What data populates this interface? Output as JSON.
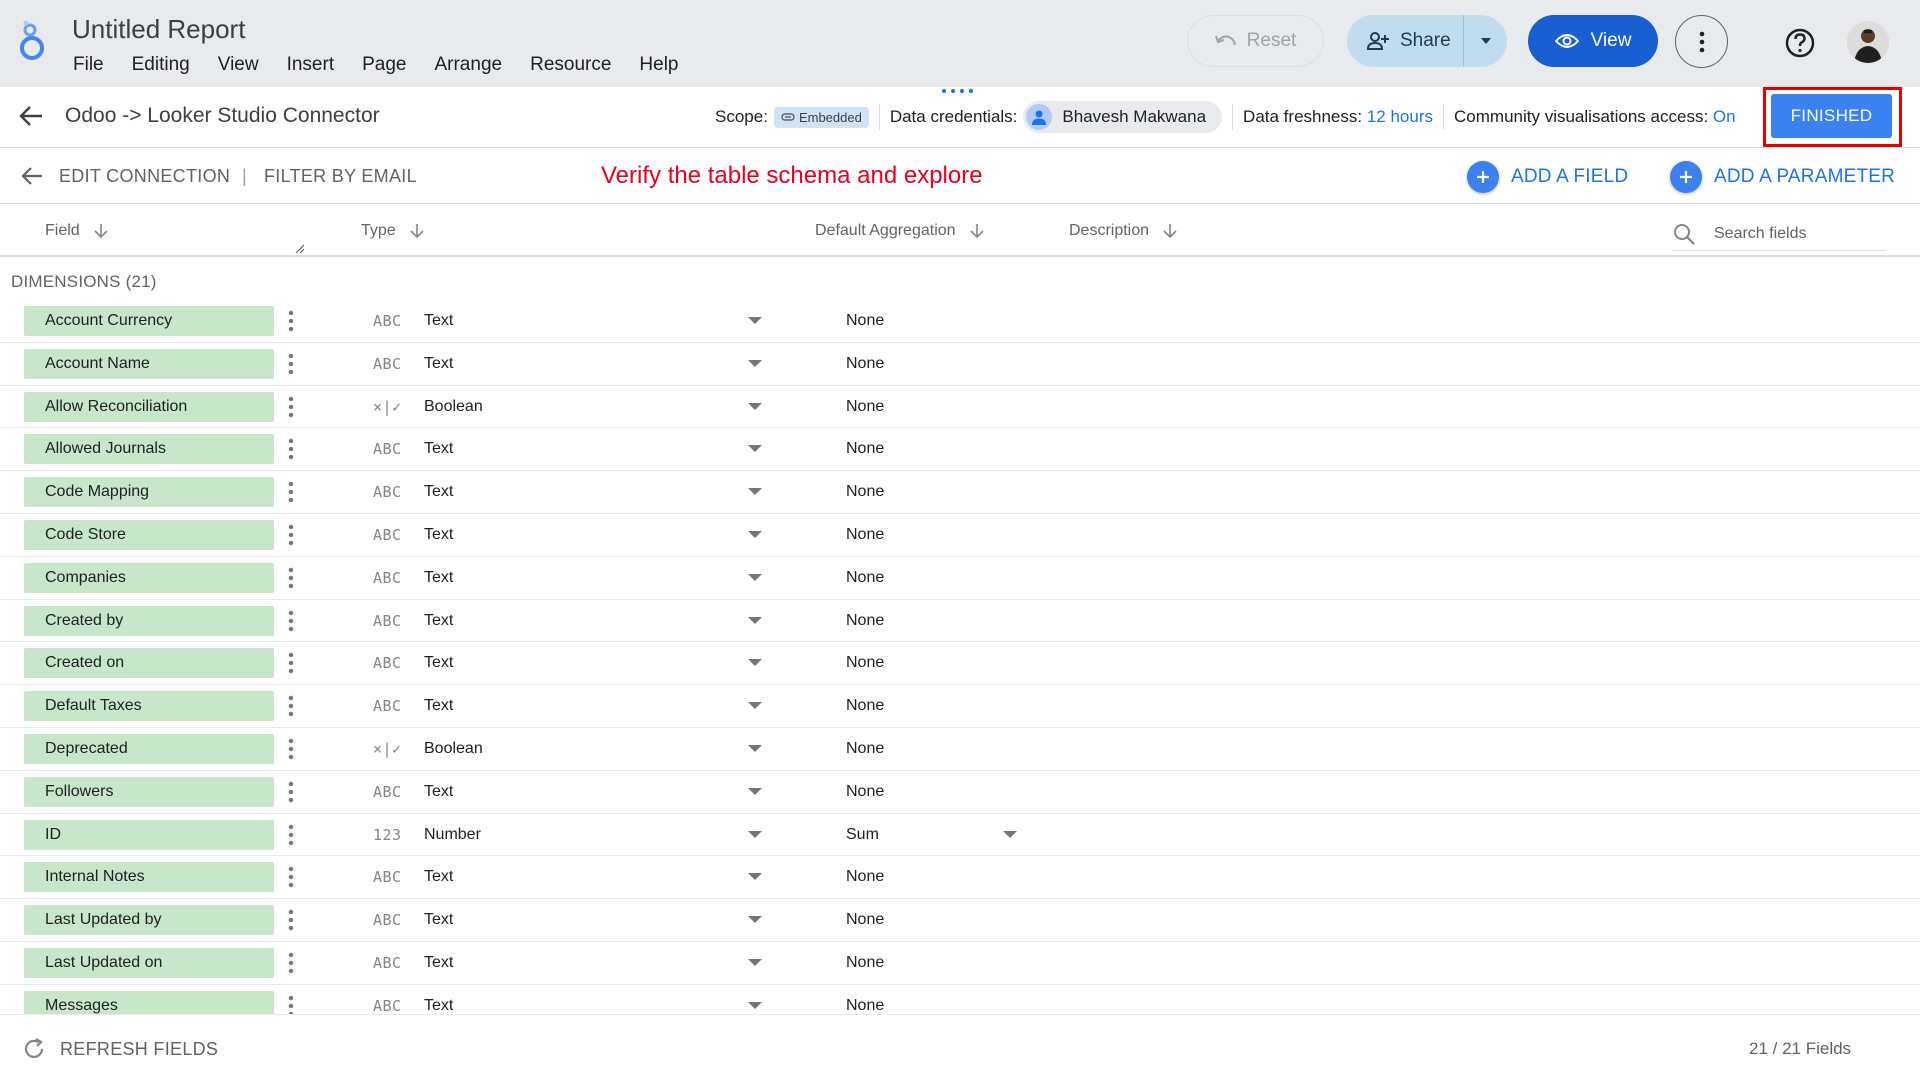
{
  "app": {
    "title": "Untitled Report",
    "menu": [
      "File",
      "Editing",
      "View",
      "Insert",
      "Page",
      "Arrange",
      "Resource",
      "Help"
    ],
    "reset_label": "Reset",
    "share_label": "Share",
    "view_label": "View",
    "accent": "#1a5fd1"
  },
  "datasource": {
    "title": "Odoo -> Looker Studio Connector",
    "scope_label": "Scope:",
    "scope_value": "Embedded",
    "credentials_label": "Data credentials:",
    "credentials_user": "Bhavesh Makwana",
    "freshness_label": "Data freshness:",
    "freshness_value": "12 hours",
    "community_label": "Community visualisations access:",
    "community_value": "On",
    "finished_label": "FINISHED"
  },
  "editbar": {
    "edit_connection": "EDIT CONNECTION",
    "separator": "|",
    "filter_by_email": "FILTER BY EMAIL",
    "annotation": "Verify the table schema and explore",
    "add_field": "ADD A FIELD",
    "add_parameter": "ADD A PARAMETER"
  },
  "columns": {
    "field": "Field",
    "type": "Type",
    "aggregation": "Default Aggregation",
    "description": "Description",
    "search_placeholder": "Search fields"
  },
  "dimensions_label": "DIMENSIONS (21)",
  "fields": [
    {
      "name": "Account Currency",
      "icon": "ABC",
      "type": "Text",
      "agg": "None"
    },
    {
      "name": "Account Name",
      "icon": "ABC",
      "type": "Text",
      "agg": "None"
    },
    {
      "name": "Allow Reconciliation",
      "icon": "×|✓",
      "type": "Boolean",
      "agg": "None"
    },
    {
      "name": "Allowed Journals",
      "icon": "ABC",
      "type": "Text",
      "agg": "None"
    },
    {
      "name": "Code Mapping",
      "icon": "ABC",
      "type": "Text",
      "agg": "None"
    },
    {
      "name": "Code Store",
      "icon": "ABC",
      "type": "Text",
      "agg": "None"
    },
    {
      "name": "Companies",
      "icon": "ABC",
      "type": "Text",
      "agg": "None"
    },
    {
      "name": "Created by",
      "icon": "ABC",
      "type": "Text",
      "agg": "None"
    },
    {
      "name": "Created on",
      "icon": "ABC",
      "type": "Text",
      "agg": "None"
    },
    {
      "name": "Default Taxes",
      "icon": "ABC",
      "type": "Text",
      "agg": "None"
    },
    {
      "name": "Deprecated",
      "icon": "×|✓",
      "type": "Boolean",
      "agg": "None"
    },
    {
      "name": "Followers",
      "icon": "ABC",
      "type": "Text",
      "agg": "None"
    },
    {
      "name": "ID",
      "icon": "123",
      "type": "Number",
      "agg": "Sum",
      "agg_dropdown": true
    },
    {
      "name": "Internal Notes",
      "icon": "ABC",
      "type": "Text",
      "agg": "None"
    },
    {
      "name": "Last Updated by",
      "icon": "ABC",
      "type": "Text",
      "agg": "None"
    },
    {
      "name": "Last Updated on",
      "icon": "ABC",
      "type": "Text",
      "agg": "None"
    },
    {
      "name": "Messages",
      "icon": "ABC",
      "type": "Text",
      "agg": "None"
    }
  ],
  "footer": {
    "refresh_label": "REFRESH FIELDS",
    "count": "21 / 21 Fields"
  }
}
